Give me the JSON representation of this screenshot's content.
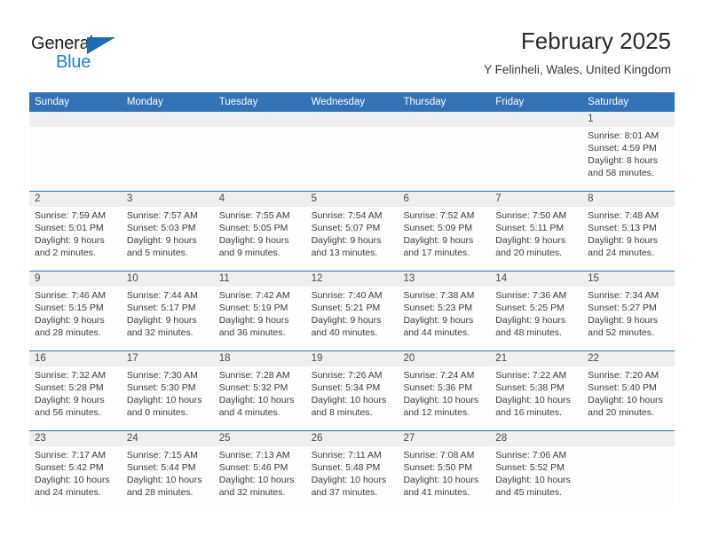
{
  "brand": {
    "name_top": "General",
    "name_bottom": "Blue",
    "triangle_color": "#1c6cb5",
    "blue_text_color": "#1c7fd4"
  },
  "header": {
    "month_title": "February 2025",
    "location": "Y Felinheli, Wales, United Kingdom"
  },
  "colors": {
    "header_blue": "#3273b5",
    "date_band_gray": "#efefef",
    "cell_white": "#fdfdfd",
    "text": "#3c3c3c"
  },
  "weekdays": [
    "Sunday",
    "Monday",
    "Tuesday",
    "Wednesday",
    "Thursday",
    "Friday",
    "Saturday"
  ],
  "weeks": [
    {
      "days": [
        {
          "date": "",
          "lines": []
        },
        {
          "date": "",
          "lines": []
        },
        {
          "date": "",
          "lines": []
        },
        {
          "date": "",
          "lines": []
        },
        {
          "date": "",
          "lines": []
        },
        {
          "date": "",
          "lines": []
        },
        {
          "date": "1",
          "lines": [
            "Sunrise: 8:01 AM",
            "Sunset: 4:59 PM",
            "Daylight: 8 hours",
            "and 58 minutes."
          ]
        }
      ]
    },
    {
      "days": [
        {
          "date": "2",
          "lines": [
            "Sunrise: 7:59 AM",
            "Sunset: 5:01 PM",
            "Daylight: 9 hours",
            "and 2 minutes."
          ]
        },
        {
          "date": "3",
          "lines": [
            "Sunrise: 7:57 AM",
            "Sunset: 5:03 PM",
            "Daylight: 9 hours",
            "and 5 minutes."
          ]
        },
        {
          "date": "4",
          "lines": [
            "Sunrise: 7:55 AM",
            "Sunset: 5:05 PM",
            "Daylight: 9 hours",
            "and 9 minutes."
          ]
        },
        {
          "date": "5",
          "lines": [
            "Sunrise: 7:54 AM",
            "Sunset: 5:07 PM",
            "Daylight: 9 hours",
            "and 13 minutes."
          ]
        },
        {
          "date": "6",
          "lines": [
            "Sunrise: 7:52 AM",
            "Sunset: 5:09 PM",
            "Daylight: 9 hours",
            "and 17 minutes."
          ]
        },
        {
          "date": "7",
          "lines": [
            "Sunrise: 7:50 AM",
            "Sunset: 5:11 PM",
            "Daylight: 9 hours",
            "and 20 minutes."
          ]
        },
        {
          "date": "8",
          "lines": [
            "Sunrise: 7:48 AM",
            "Sunset: 5:13 PM",
            "Daylight: 9 hours",
            "and 24 minutes."
          ]
        }
      ]
    },
    {
      "days": [
        {
          "date": "9",
          "lines": [
            "Sunrise: 7:46 AM",
            "Sunset: 5:15 PM",
            "Daylight: 9 hours",
            "and 28 minutes."
          ]
        },
        {
          "date": "10",
          "lines": [
            "Sunrise: 7:44 AM",
            "Sunset: 5:17 PM",
            "Daylight: 9 hours",
            "and 32 minutes."
          ]
        },
        {
          "date": "11",
          "lines": [
            "Sunrise: 7:42 AM",
            "Sunset: 5:19 PM",
            "Daylight: 9 hours",
            "and 36 minutes."
          ]
        },
        {
          "date": "12",
          "lines": [
            "Sunrise: 7:40 AM",
            "Sunset: 5:21 PM",
            "Daylight: 9 hours",
            "and 40 minutes."
          ]
        },
        {
          "date": "13",
          "lines": [
            "Sunrise: 7:38 AM",
            "Sunset: 5:23 PM",
            "Daylight: 9 hours",
            "and 44 minutes."
          ]
        },
        {
          "date": "14",
          "lines": [
            "Sunrise: 7:36 AM",
            "Sunset: 5:25 PM",
            "Daylight: 9 hours",
            "and 48 minutes."
          ]
        },
        {
          "date": "15",
          "lines": [
            "Sunrise: 7:34 AM",
            "Sunset: 5:27 PM",
            "Daylight: 9 hours",
            "and 52 minutes."
          ]
        }
      ]
    },
    {
      "days": [
        {
          "date": "16",
          "lines": [
            "Sunrise: 7:32 AM",
            "Sunset: 5:28 PM",
            "Daylight: 9 hours",
            "and 56 minutes."
          ]
        },
        {
          "date": "17",
          "lines": [
            "Sunrise: 7:30 AM",
            "Sunset: 5:30 PM",
            "Daylight: 10 hours",
            "and 0 minutes."
          ]
        },
        {
          "date": "18",
          "lines": [
            "Sunrise: 7:28 AM",
            "Sunset: 5:32 PM",
            "Daylight: 10 hours",
            "and 4 minutes."
          ]
        },
        {
          "date": "19",
          "lines": [
            "Sunrise: 7:26 AM",
            "Sunset: 5:34 PM",
            "Daylight: 10 hours",
            "and 8 minutes."
          ]
        },
        {
          "date": "20",
          "lines": [
            "Sunrise: 7:24 AM",
            "Sunset: 5:36 PM",
            "Daylight: 10 hours",
            "and 12 minutes."
          ]
        },
        {
          "date": "21",
          "lines": [
            "Sunrise: 7:22 AM",
            "Sunset: 5:38 PM",
            "Daylight: 10 hours",
            "and 16 minutes."
          ]
        },
        {
          "date": "22",
          "lines": [
            "Sunrise: 7:20 AM",
            "Sunset: 5:40 PM",
            "Daylight: 10 hours",
            "and 20 minutes."
          ]
        }
      ]
    },
    {
      "days": [
        {
          "date": "23",
          "lines": [
            "Sunrise: 7:17 AM",
            "Sunset: 5:42 PM",
            "Daylight: 10 hours",
            "and 24 minutes."
          ]
        },
        {
          "date": "24",
          "lines": [
            "Sunrise: 7:15 AM",
            "Sunset: 5:44 PM",
            "Daylight: 10 hours",
            "and 28 minutes."
          ]
        },
        {
          "date": "25",
          "lines": [
            "Sunrise: 7:13 AM",
            "Sunset: 5:46 PM",
            "Daylight: 10 hours",
            "and 32 minutes."
          ]
        },
        {
          "date": "26",
          "lines": [
            "Sunrise: 7:11 AM",
            "Sunset: 5:48 PM",
            "Daylight: 10 hours",
            "and 37 minutes."
          ]
        },
        {
          "date": "27",
          "lines": [
            "Sunrise: 7:08 AM",
            "Sunset: 5:50 PM",
            "Daylight: 10 hours",
            "and 41 minutes."
          ]
        },
        {
          "date": "28",
          "lines": [
            "Sunrise: 7:06 AM",
            "Sunset: 5:52 PM",
            "Daylight: 10 hours",
            "and 45 minutes."
          ]
        },
        {
          "date": "",
          "lines": []
        }
      ]
    }
  ]
}
